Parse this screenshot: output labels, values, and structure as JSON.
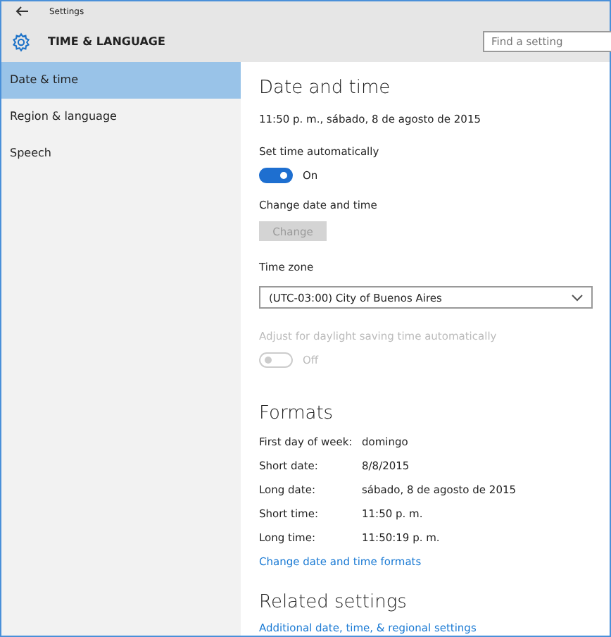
{
  "window": {
    "title": "Settings"
  },
  "header": {
    "title": "TIME & LANGUAGE",
    "search": {
      "placeholder": "Find a setting"
    }
  },
  "sidebar": {
    "items": [
      {
        "label": "Date & time",
        "selected": true
      },
      {
        "label": "Region & language",
        "selected": false
      },
      {
        "label": "Speech",
        "selected": false
      }
    ]
  },
  "main": {
    "title": "Date and time",
    "current": "11:50 p. m., sábado, 8 de agosto de 2015",
    "auto_time": {
      "label": "Set time automatically",
      "on": true,
      "state": "On",
      "disabled": false
    },
    "change": {
      "label": "Change date and time",
      "button": "Change",
      "disabled": true
    },
    "time_zone": {
      "label": "Time zone",
      "value": "(UTC-03:00) City of Buenos Aires"
    },
    "dst": {
      "label": "Adjust for daylight saving time automatically",
      "on": false,
      "state": "Off",
      "disabled": true
    },
    "formats": {
      "title": "Formats",
      "rows": [
        {
          "label": "First day of week:",
          "value": "domingo"
        },
        {
          "label": "Short date:",
          "value": "8/8/2015"
        },
        {
          "label": "Long date:",
          "value": "sábado, 8 de agosto de 2015"
        },
        {
          "label": "Short time:",
          "value": "11:50 p. m."
        },
        {
          "label": "Long time:",
          "value": "11:50:19 p. m."
        }
      ],
      "link": "Change date and time formats"
    },
    "related": {
      "title": "Related settings",
      "link": "Additional date, time, & regional settings"
    }
  }
}
